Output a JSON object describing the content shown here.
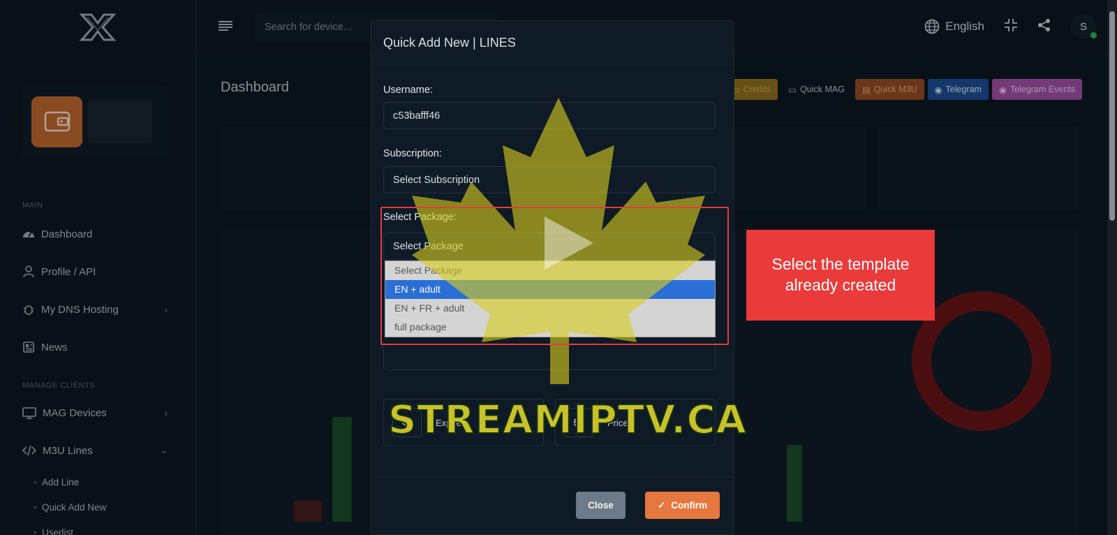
{
  "header": {
    "search_placeholder": "Search for device...",
    "language": "English",
    "avatar_initial": "S"
  },
  "sidebar": {
    "section_main": "MAIN",
    "section_manage": "MANAGE CLIENTS",
    "items": [
      {
        "label": "Dashboard"
      },
      {
        "label": "Profile / API"
      },
      {
        "label": "My DNS Hosting"
      },
      {
        "label": "News"
      },
      {
        "label": "MAG Devices"
      },
      {
        "label": "M3U Lines"
      }
    ],
    "sub_items": [
      {
        "label": "Add Line"
      },
      {
        "label": "Quick Add New"
      },
      {
        "label": "Userlist"
      }
    ]
  },
  "main": {
    "page_title": "Dashboard",
    "quick_buttons": [
      {
        "label": "Credits",
        "bg": "#8a6a1c",
        "fg": "#c9a44a"
      },
      {
        "label": "Quick MAG",
        "bg": "#0c1620",
        "fg": "#b7c1ca"
      },
      {
        "label": "Quick M3U",
        "bg": "#8f4a23",
        "fg": "#e0a27a"
      },
      {
        "label": "Telegram",
        "bg": "#1c4b8f",
        "fg": "#cfe0f6"
      },
      {
        "label": "Telegram Events",
        "bg": "#9b4d9f",
        "fg": "#e7c6ea"
      }
    ]
  },
  "modal": {
    "title": "Quick Add New | LINES",
    "username_label": "Username:",
    "username_value": "c53bafff46",
    "subscription_label": "Subscription:",
    "subscription_value": "Select Subscription",
    "package_label": "Select Package:",
    "package_value": "Select Package",
    "package_options": [
      "Select Package",
      "EN + adult",
      "EN + FR + adult",
      "full package"
    ],
    "package_highlighted": "EN + adult",
    "expire_label": "Expire",
    "price_label": "Price",
    "close_label": "Close",
    "confirm_label": "Confirm"
  },
  "annotation": {
    "callout_text": "Select the template already created",
    "watermark_text": "STREAMIPTV.CA"
  },
  "colors": {
    "accent_orange": "#e5773f",
    "callout_red": "#ea3a3a",
    "selected_blue": "#2a6fd6"
  }
}
